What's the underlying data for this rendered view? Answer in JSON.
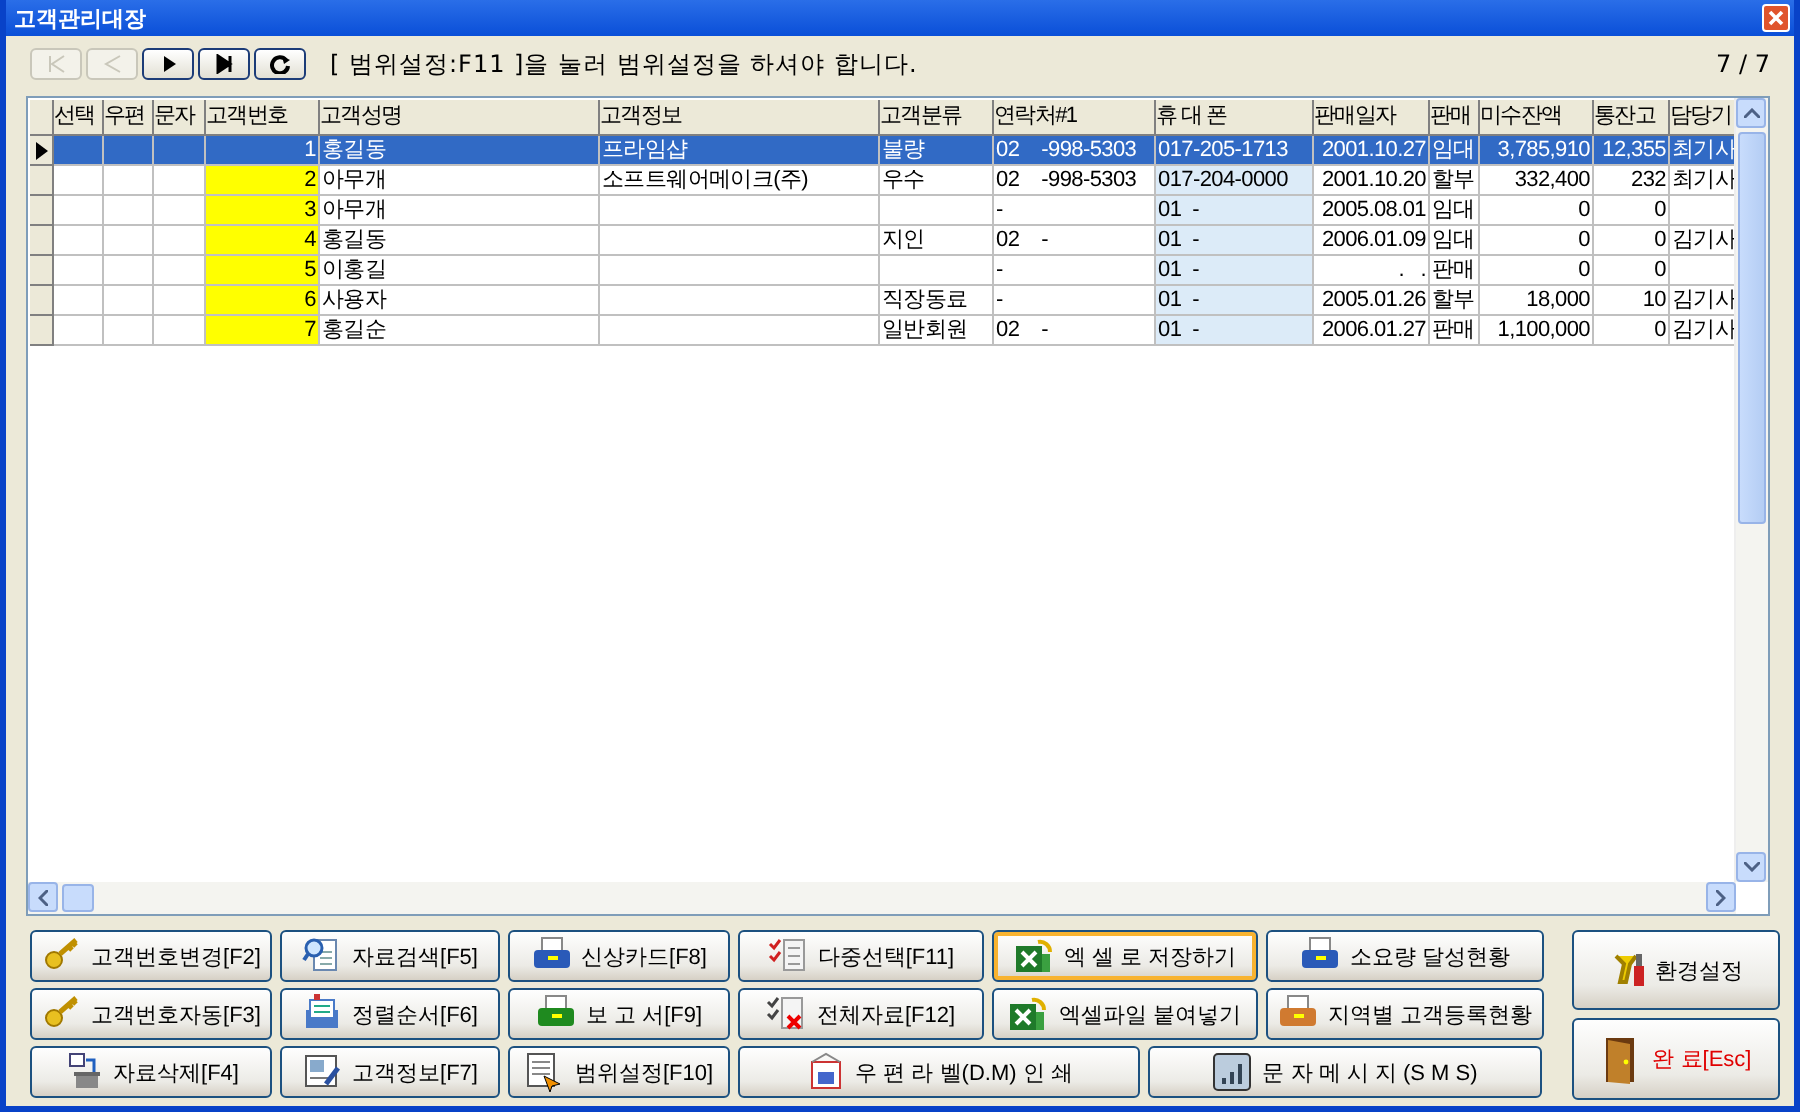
{
  "window": {
    "title": "고객관리대장"
  },
  "toolbar": {
    "nav_buttons": [
      {
        "disabled": true
      },
      {
        "disabled": true
      },
      {
        "disabled": false
      },
      {
        "disabled": false
      },
      {
        "disabled": false
      }
    ],
    "message": "[ 범위설정:F11 ]을 눌러 범위설정을 하셔야 합니다.",
    "record_count": "7 / 7"
  },
  "table": {
    "columns": [
      "선택",
      "우편",
      "문자",
      "고객번호",
      "고객성명",
      "고객정보",
      "고객분류",
      "연락처#1",
      "휴 대 폰",
      "판매일자",
      "판매",
      "미수잔액",
      "통잔고",
      "담당기"
    ],
    "rows": [
      {
        "selected": true,
        "customer_no": "1",
        "name": "홍길동",
        "info": "프라임샵",
        "category": "불량",
        "phone": "02    -998-5303",
        "mobile": "017-205-1713",
        "sale_date": "2001.10.27",
        "sale_type": "임대",
        "balance": "3,785,910",
        "account": "12,355",
        "manager": "최기사"
      },
      {
        "selected": false,
        "customer_no": "2",
        "name": "아무개",
        "info": "소프트웨어메이크(주)",
        "category": "우수",
        "phone": "02    -998-5303",
        "mobile": "017-204-0000",
        "sale_date": "2001.10.20",
        "sale_type": "할부",
        "balance": "332,400",
        "account": "232",
        "manager": "최기사"
      },
      {
        "selected": false,
        "customer_no": "3",
        "name": "아무개",
        "phone": "-",
        "mobile": "01  -",
        "sale_date": "2005.08.01",
        "sale_type": "임대",
        "balance": "0",
        "account": "0"
      },
      {
        "selected": false,
        "customer_no": "4",
        "name": "홍길동",
        "category": "지인",
        "phone": "02    -",
        "mobile": "01  -",
        "sale_date": "2006.01.09",
        "sale_type": "임대",
        "balance": "0",
        "account": "0",
        "manager": "김기사"
      },
      {
        "selected": false,
        "customer_no": "5",
        "name": "이홍길",
        "phone": "-",
        "mobile": "01  -",
        "sale_date": ".   .",
        "sale_type": "판매",
        "balance": "0",
        "account": "0"
      },
      {
        "selected": false,
        "customer_no": "6",
        "name": "사용자",
        "category": "직장동료",
        "phone": "-",
        "mobile": "01  -",
        "sale_date": "2005.01.26",
        "sale_type": "할부",
        "balance": "18,000",
        "account": "10",
        "manager": "김기사"
      },
      {
        "selected": false,
        "customer_no": "7",
        "name": "홍길순",
        "category": "일반회원",
        "phone": "02    -",
        "mobile": "01  -",
        "sale_date": "2006.01.27",
        "sale_type": "판매",
        "balance": "1,100,000",
        "account": "0",
        "manager": "김기사"
      }
    ]
  },
  "button_rows": [
    [
      {
        "label": "고객번호변경[F2]",
        "highlighted": false
      },
      {
        "label": "자료검색[F5]",
        "highlighted": false
      },
      {
        "label": "신상카드[F8]",
        "highlighted": false
      },
      {
        "label": "다중선택[F11]",
        "highlighted": false
      },
      {
        "label": "엑 셀 로 저장하기",
        "highlighted": true
      },
      {
        "label": "소요량 달성현황",
        "highlighted": false
      }
    ],
    [
      {
        "label": "고객번호자동[F3]",
        "highlighted": false
      },
      {
        "label": "정렬순서[F6]",
        "highlighted": false
      },
      {
        "label": "보 고 서[F9]",
        "highlighted": false
      },
      {
        "label": "전체자료[F12]",
        "highlighted": false
      },
      {
        "label": "엑셀파일 붙여넣기",
        "highlighted": false
      },
      {
        "label": "지역별 고객등록현황",
        "highlighted": false
      }
    ],
    [
      {
        "label": "자료삭제[F4]",
        "highlighted": false
      },
      {
        "label": "고객정보[F7]",
        "highlighted": false
      },
      {
        "label": "범위설정[F10]",
        "highlighted": false
      },
      {
        "label": "우 편 라 벨(D.M) 인 쇄",
        "highlighted": false
      },
      {
        "label": "문 자 메 시 지 (S M S)",
        "highlighted": false
      }
    ]
  ],
  "side_buttons": [
    {
      "kind": "settings",
      "label": "환경설정"
    },
    {
      "kind": "exit",
      "label": "완 료[Esc]"
    }
  ]
}
